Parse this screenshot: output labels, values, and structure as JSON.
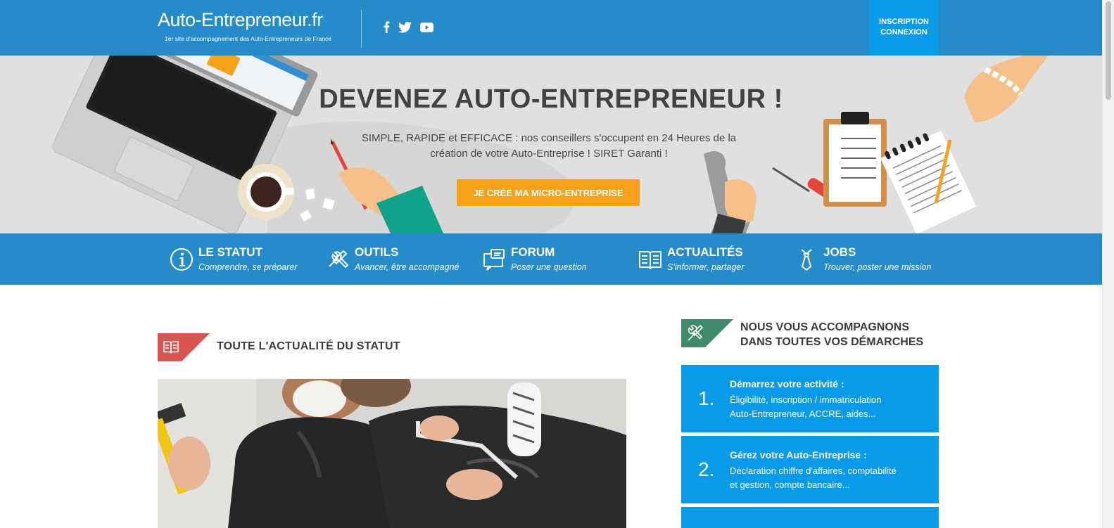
{
  "header": {
    "logo_main": "Auto-Entrepreneur",
    "logo_tld": ".fr",
    "logo_tagline": "1er site d'accompagnement des Auto-Entrepreneurs de France",
    "social": [
      "facebook-icon",
      "twitter-icon",
      "youtube-icon"
    ],
    "signup_label": "INSCRIPTION",
    "login_label": "CONNEXION"
  },
  "hero": {
    "title": "DEVENEZ AUTO-ENTREPRENEUR !",
    "text_line1": "SIMPLE, RAPIDE et EFFICACE : nos conseillers s'occupent en 24 Heures de la",
    "text_line2": "création de votre Auto-Entreprise ! SIRET Garanti !",
    "cta_label": "JE CRÉE MA MICRO-ENTREPRISE"
  },
  "nav": {
    "items": [
      {
        "title": "LE STATUT",
        "subtitle": "Comprendre, se préparer",
        "icon": "info-icon"
      },
      {
        "title": "OUTILS",
        "subtitle": "Avancer, être accompagné",
        "icon": "tools-icon"
      },
      {
        "title": "FORUM",
        "subtitle": "Poser une question",
        "icon": "forum-icon"
      },
      {
        "title": "ACTUALITÉS",
        "subtitle": "S'informer, partager",
        "icon": "book-icon"
      },
      {
        "title": "JOBS",
        "subtitle": "Trouver, poster une mission",
        "icon": "tie-icon"
      }
    ]
  },
  "news": {
    "title": "TOUTE L'ACTUALITÉ DU STATUT"
  },
  "support": {
    "title_line1": "NOUS VOUS ACCOMPAGNONS",
    "title_line2": "DANS TOUTES VOS DÉMARCHES",
    "steps": [
      {
        "num": "1.",
        "title": "Démarrez votre activité :",
        "desc_line1": "Éligibilité, inscription / immatriculation",
        "desc_line2": "Auto-Entrepreneur, ACCRE, aides..."
      },
      {
        "num": "2.",
        "title": "Gérez votre Auto-Entreprise :",
        "desc_line1": "Déclaration chiffre d'affaires, comptabilité",
        "desc_line2": "et gestion, compte bancaire..."
      }
    ]
  },
  "colors": {
    "header_blue": "#258bc9",
    "accent_blue": "#0a9be8",
    "cta_orange": "#f7a11a",
    "badge_red": "#d9534f",
    "badge_green": "#3f8a6a"
  }
}
